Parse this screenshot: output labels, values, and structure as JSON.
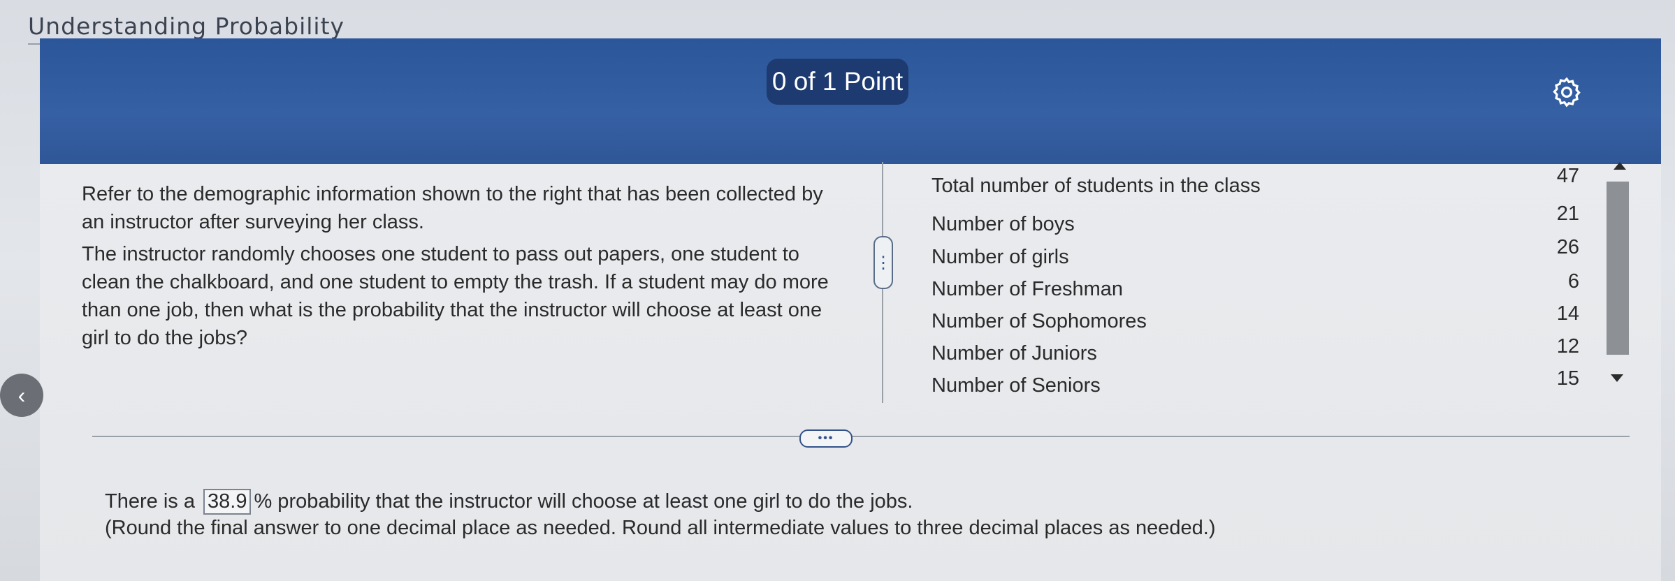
{
  "page": {
    "title": "Understanding Probability"
  },
  "header": {
    "points": "0 of 1 Point",
    "settings_icon": "gear-icon"
  },
  "question": {
    "paragraph1": "Refer to the demographic information shown to the right that has been collected by an instructor after surveying her class.",
    "paragraph2": "The instructor randomly chooses one student to pass out papers, one student to clean the chalkboard, and one student to empty the trash. If a student may do more than one job, then what is the probability that the instructor will choose at least one girl to do the jobs?"
  },
  "demographics": [
    {
      "label": "Total number of students in the class",
      "value": "47"
    },
    {
      "label": "Number of boys",
      "value": "21"
    },
    {
      "label": "Number of girls",
      "value": "26"
    },
    {
      "label": "Number of Freshman",
      "value": "6"
    },
    {
      "label": "Number of Sophomores",
      "value": "14"
    },
    {
      "label": "Number of Juniors",
      "value": "12"
    },
    {
      "label": "Number of Seniors",
      "value": "15"
    }
  ],
  "answer": {
    "prefix": "There is a",
    "value": "38.9",
    "suffix": "% probability that the instructor will choose at least one girl to do the jobs.",
    "note": "(Round the final answer to one decimal place as needed. Round all intermediate values to three decimal places as needed.)"
  },
  "controls": {
    "expand_label": "•••",
    "handle_label": "⋮",
    "back_label": "‹"
  },
  "colors": {
    "banner": "#2f5797",
    "pill": "#1d3b70"
  }
}
